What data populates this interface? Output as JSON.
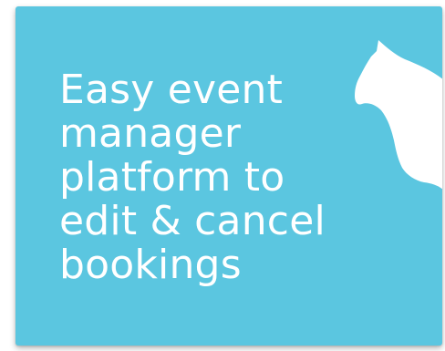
{
  "card": {
    "background_color": "#5bc6e0",
    "text_color": "#ffffff",
    "headline_lines": [
      "Easy event",
      "manager",
      "platform to",
      "edit & cancel",
      "bookings"
    ],
    "decoration_icon": "horse-head-silhouette-icon"
  }
}
